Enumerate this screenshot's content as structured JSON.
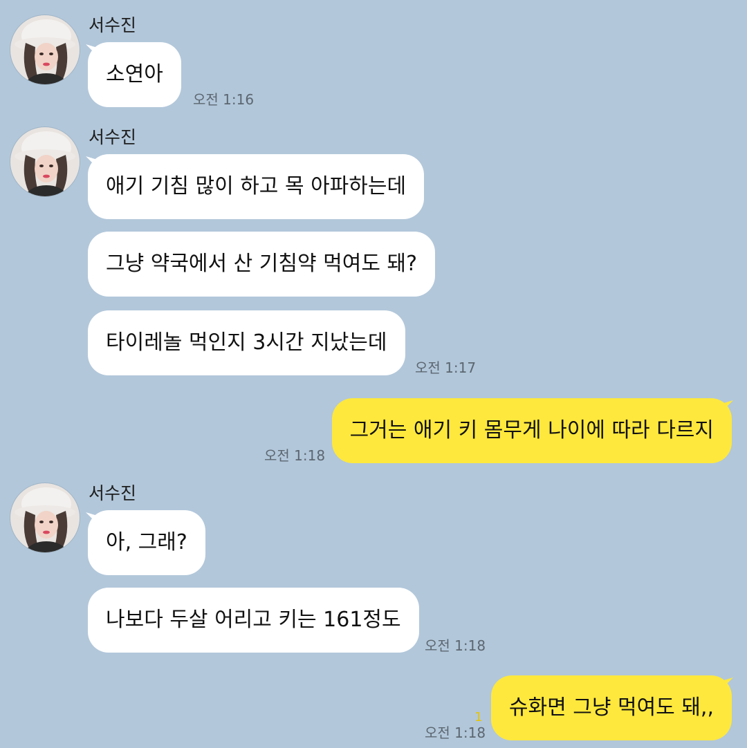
{
  "conversation": {
    "sender_name": "서수진",
    "group1": {
      "messages": [
        "소연아"
      ],
      "time": "오전 1:16"
    },
    "group2": {
      "messages": [
        "애기 기침 많이 하고 목 아파하는데",
        "그냥 약국에서 산 기침약 먹여도 돼?",
        "타이레놀 먹인지 3시간 지났는데"
      ],
      "time": "오전 1:17"
    },
    "my1": {
      "message": "그거는 애기 키 몸무게 나이에 따라 다르지",
      "time": "오전 1:18"
    },
    "group3": {
      "messages": [
        "아, 그래?",
        "나보다 두살 어리고 키는 161정도"
      ],
      "time": "오전 1:18"
    },
    "my2": {
      "message": "슈화면 그냥 먹여도 돼,,",
      "unread": "1",
      "time": "오전 1:18"
    }
  },
  "colors": {
    "background": "#b2c7da",
    "incoming_bubble": "#ffffff",
    "outgoing_bubble": "#fee83d",
    "unread_count": "#e7c400"
  }
}
